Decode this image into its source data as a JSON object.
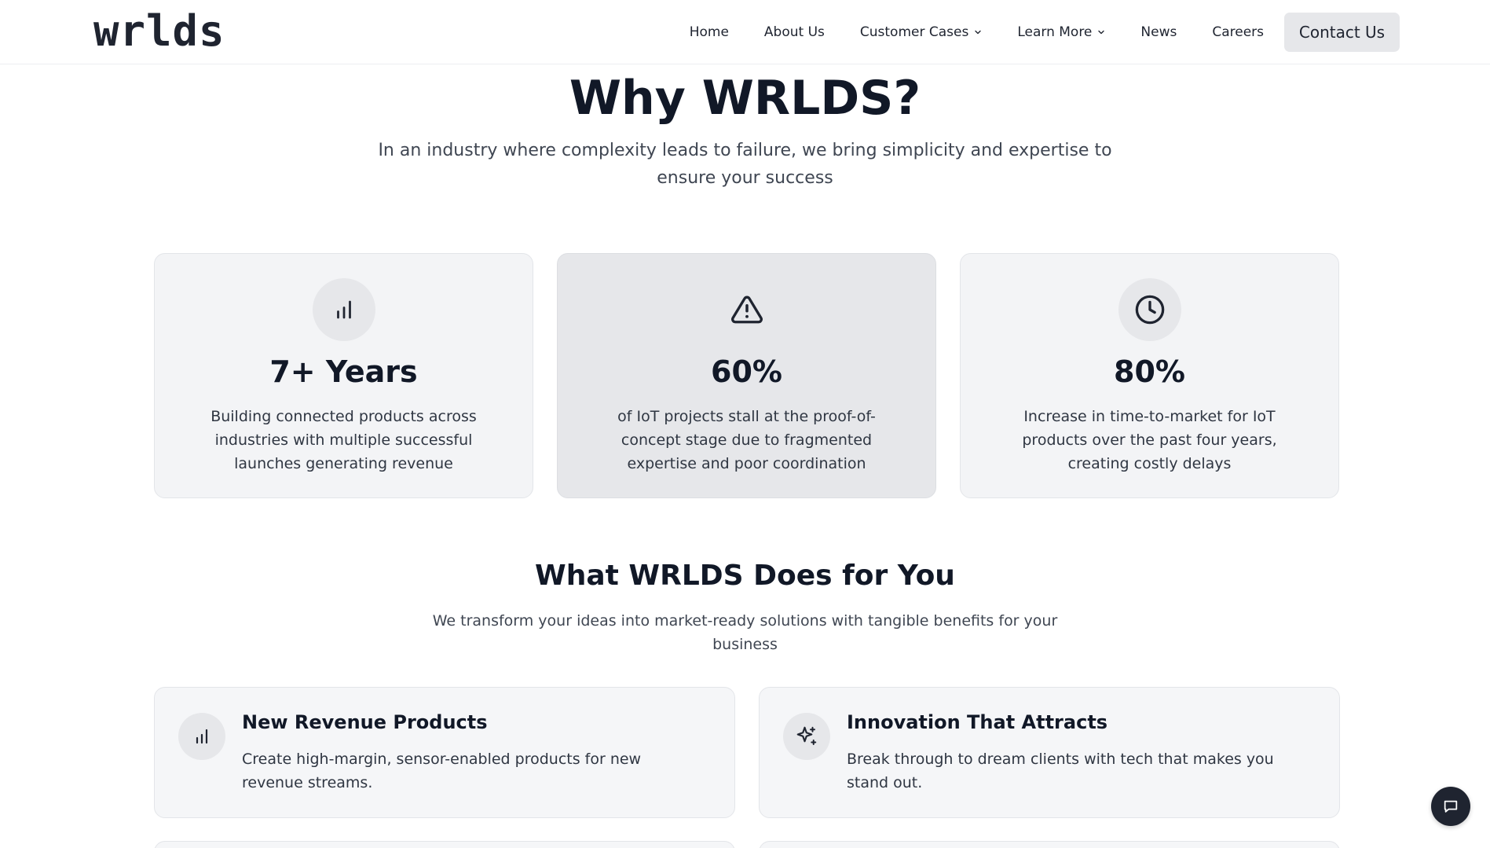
{
  "brand": {
    "logo_text": "wrlds"
  },
  "nav": {
    "items": [
      {
        "label": "Home",
        "has_dropdown": false
      },
      {
        "label": "About Us",
        "has_dropdown": false
      },
      {
        "label": "Customer Cases",
        "has_dropdown": true
      },
      {
        "label": "Learn More",
        "has_dropdown": true
      },
      {
        "label": "News",
        "has_dropdown": false
      },
      {
        "label": "Careers",
        "has_dropdown": false
      }
    ],
    "contact_label": "Contact Us"
  },
  "why": {
    "title": "Why WRLDS?",
    "subtitle": "In an industry where complexity leads to failure, we bring simplicity and expertise to ensure your success",
    "stats": [
      {
        "icon": "bar-chart-icon",
        "value": "7+ Years",
        "description": "Building connected products across industries with multiple successful launches generating revenue"
      },
      {
        "icon": "alert-triangle-icon",
        "value": "60%",
        "description": "of IoT projects stall at the proof-of-concept stage due to fragmented expertise and poor coordination"
      },
      {
        "icon": "clock-icon",
        "value": "80%",
        "description": "Increase in time-to-market for IoT products over the past four years, creating costly delays"
      }
    ]
  },
  "what": {
    "title": "What WRLDS Does for You",
    "subtitle": "We transform your ideas into market-ready solutions with tangible benefits for your business",
    "features": [
      {
        "icon": "bar-chart-icon",
        "title": "New Revenue Products",
        "description": "Create high-margin, sensor-enabled products for new revenue streams."
      },
      {
        "icon": "sparkles-icon",
        "title": "Innovation That Attracts",
        "description": "Break through to dream clients with tech that makes you stand out."
      }
    ]
  },
  "colors": {
    "dark": "#1f2430",
    "card_bg": "#f3f4f6",
    "card_highlight": "#e6e7ea",
    "text_muted": "#3f4652"
  }
}
